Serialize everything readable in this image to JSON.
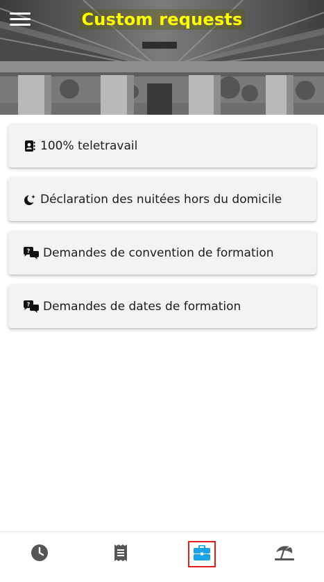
{
  "header": {
    "title": "Custom requests",
    "title_color": "#ffff00",
    "menu_icon": "hamburger-menu-icon"
  },
  "requests": [
    {
      "label": "100% teletravail",
      "icon": "contact-book-icon"
    },
    {
      "label": "Déclaration des nuitées hors du domicile",
      "icon": "moon-stars-icon"
    },
    {
      "label": "Demandes de convention de formation",
      "icon": "question-comments-icon"
    },
    {
      "label": "Demandes de dates de formation",
      "icon": "question-comments-icon"
    }
  ],
  "bottom_nav": {
    "items": [
      {
        "icon": "clock-icon",
        "active": false
      },
      {
        "icon": "receipt-icon",
        "active": false
      },
      {
        "icon": "briefcase-icon",
        "active": true
      },
      {
        "icon": "beach-umbrella-icon",
        "active": false
      }
    ],
    "active_color": "#1aa3e8",
    "inactive_color": "#555555",
    "highlight_color": "#e01e1e"
  }
}
